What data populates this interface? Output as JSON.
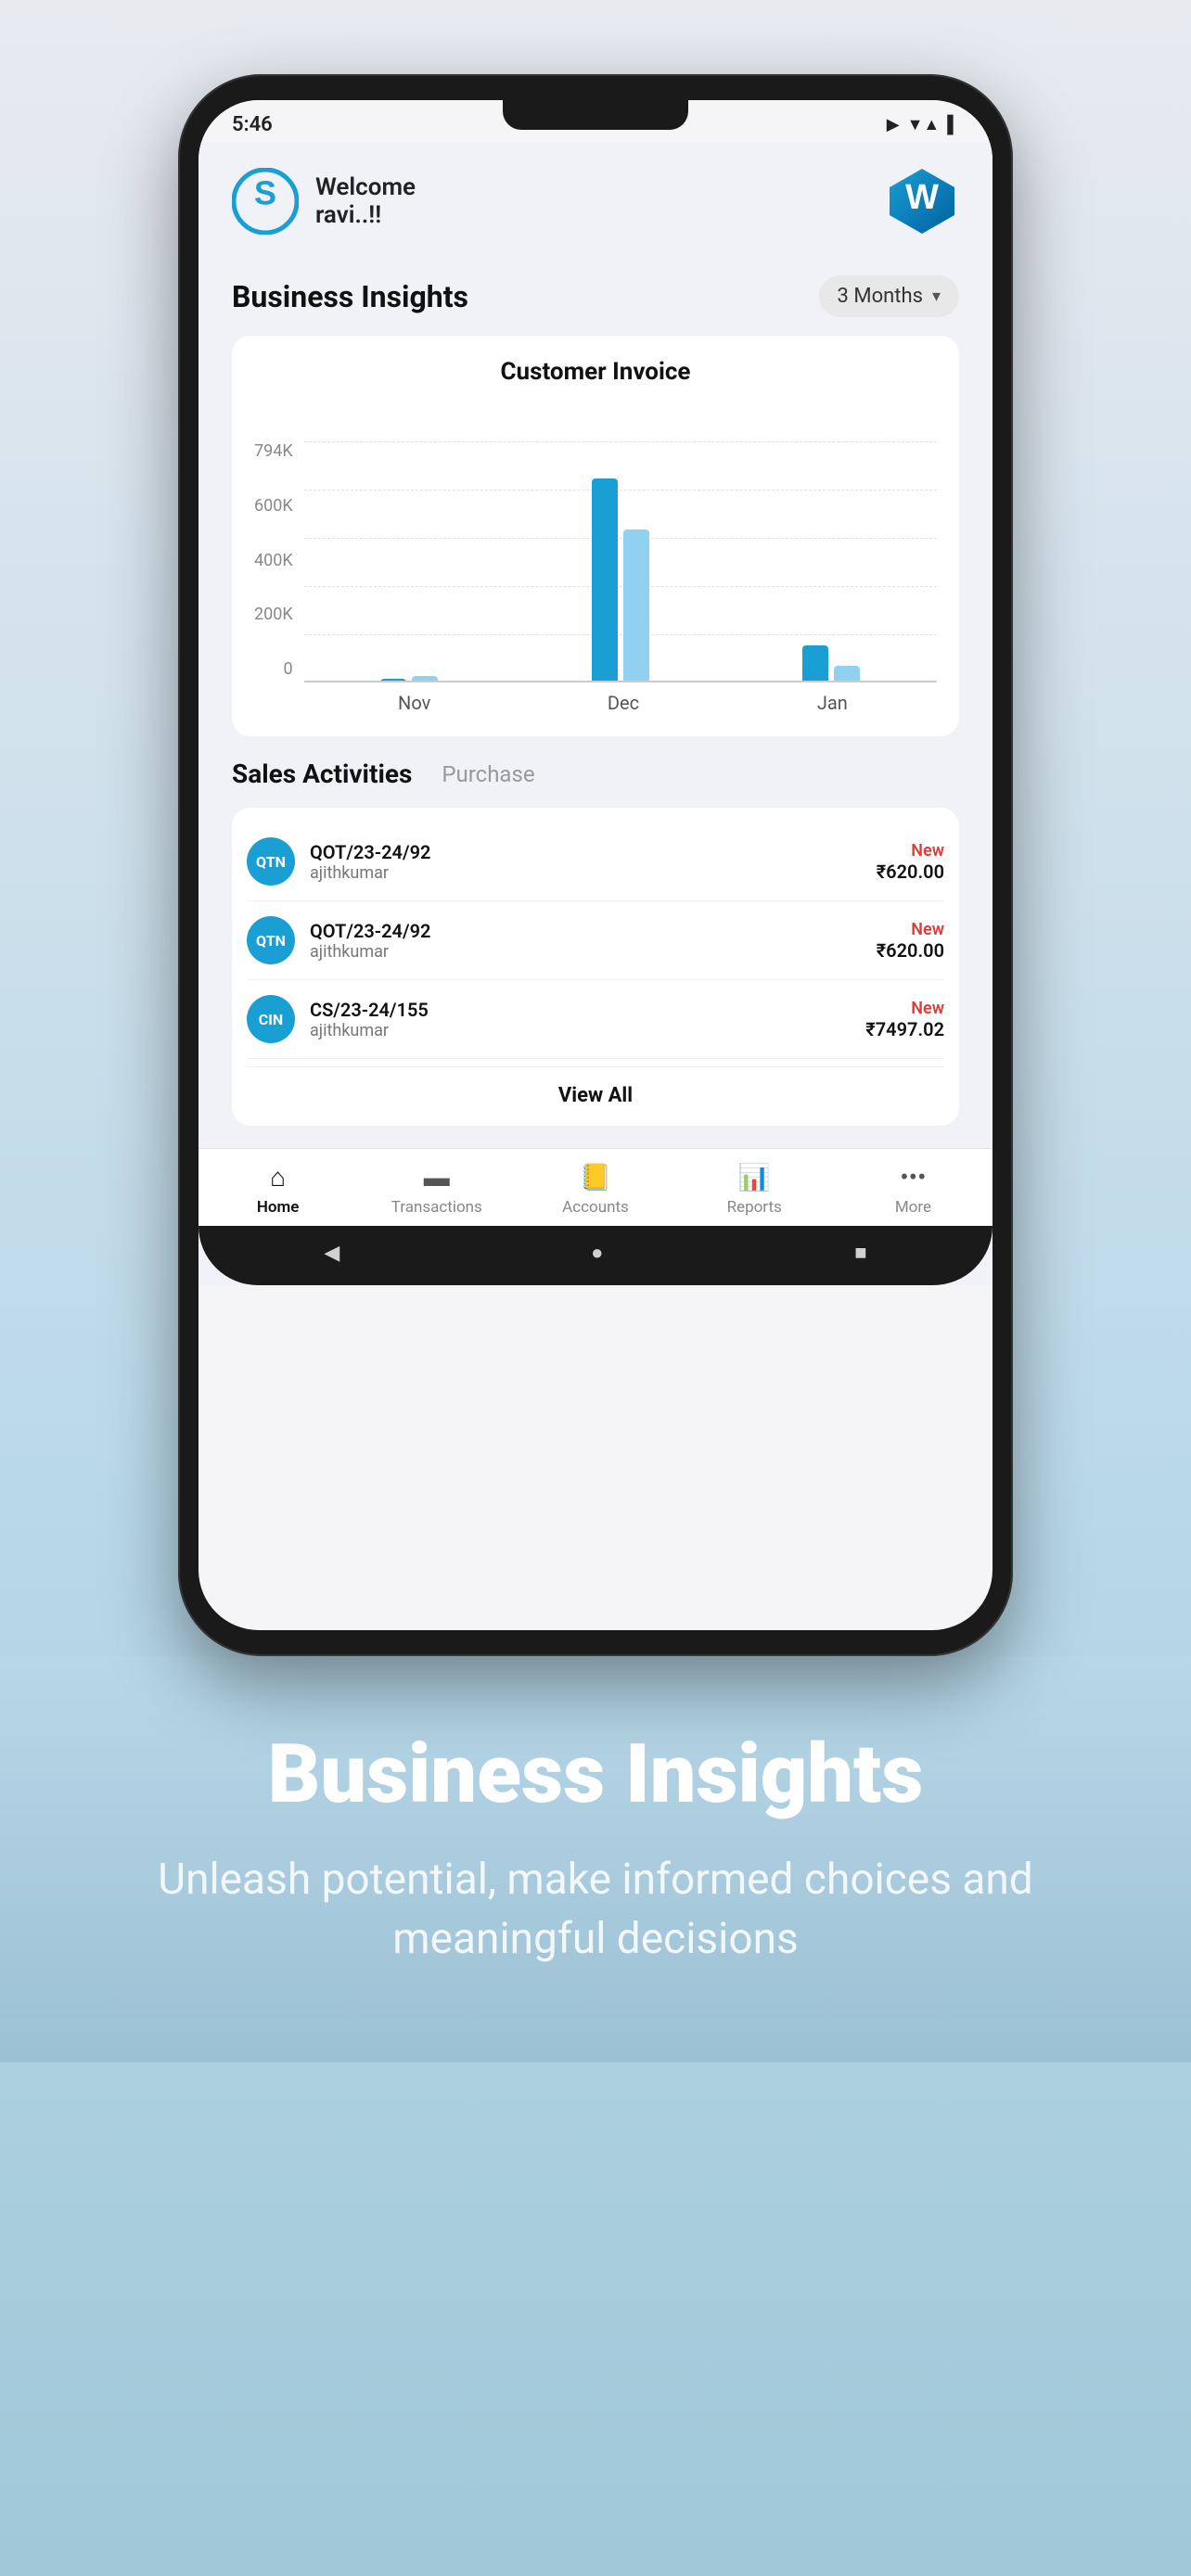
{
  "statusBar": {
    "time": "5:46",
    "icons": [
      "▶",
      "▼▲",
      "▌"
    ]
  },
  "header": {
    "welcomeText": "Welcome",
    "userName": "ravi..!!",
    "logoAlt": "S logo"
  },
  "insightsSection": {
    "title": "Business Insights",
    "dropdownLabel": "3 Months"
  },
  "chart": {
    "title": "Customer Invoice",
    "yLabels": [
      "794K",
      "600K",
      "400K",
      "200K",
      "0"
    ],
    "xLabels": [
      "Nov",
      "Dec",
      "Jan"
    ],
    "bars": {
      "Nov": {
        "dark": 4,
        "light": 6
      },
      "Dec": {
        "dark": 220,
        "light": 160
      },
      "Jan": {
        "dark": 40,
        "light": 20
      }
    }
  },
  "activitiesSection": {
    "title": "Sales Activities",
    "inactiveTab": "Purchase",
    "items": [
      {
        "avatar": "QTN",
        "ref": "QOT/23-24/92",
        "customer": "ajithkumar",
        "status": "New",
        "amount": "₹620.00"
      },
      {
        "avatar": "QTN",
        "ref": "QOT/23-24/92",
        "customer": "ajithkumar",
        "status": "New",
        "amount": "₹620.00"
      },
      {
        "avatar": "CIN",
        "ref": "CS/23-24/155",
        "customer": "ajithkumar",
        "status": "New",
        "amount": "₹7497.02"
      }
    ],
    "viewAllLabel": "View All"
  },
  "bottomNav": {
    "items": [
      {
        "icon": "🏠",
        "label": "Home",
        "active": true
      },
      {
        "icon": "💳",
        "label": "Transactions",
        "active": false
      },
      {
        "icon": "📒",
        "label": "Accounts",
        "active": false
      },
      {
        "icon": "📊",
        "label": "Reports",
        "active": false
      },
      {
        "icon": "•••",
        "label": "More",
        "active": false
      }
    ]
  },
  "androidNav": {
    "back": "◀",
    "home": "●",
    "recent": "■"
  },
  "bottomSection": {
    "title": "Business Insights",
    "subtitle": "Unleash potential, make informed choices and meaningful decisions"
  }
}
